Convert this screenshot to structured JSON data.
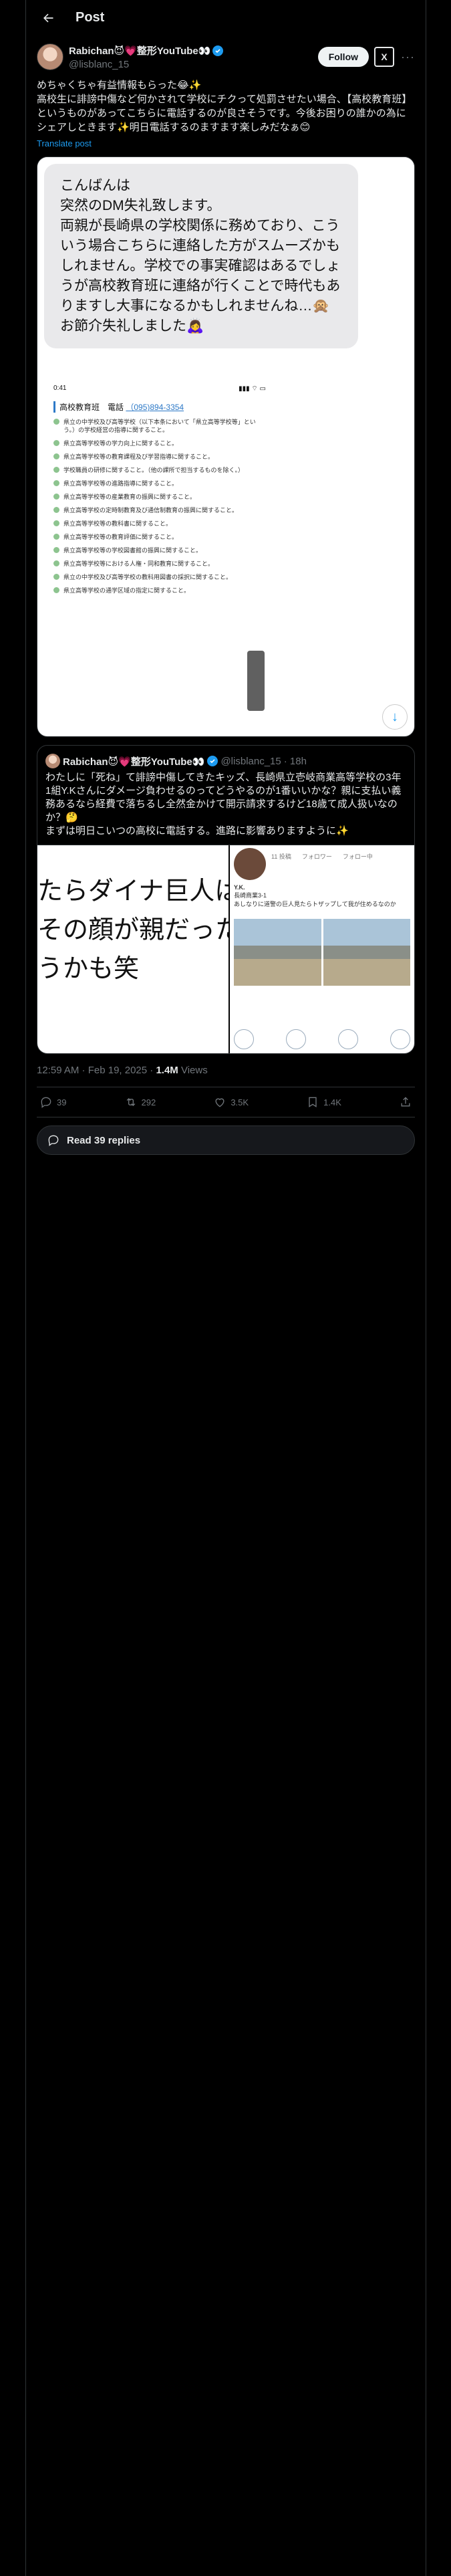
{
  "header": {
    "title": "Post"
  },
  "author": {
    "name": "Rabichan😈💗整形YouTube👀",
    "handle": "@lisblanc_15",
    "follow_label": "Follow",
    "grok_label": "X"
  },
  "tweet": {
    "text": "めちゃくちゃ有益情報もらった😂✨\n高校生に誹謗中傷など何かされて学校にチクって処罰させたい場合、【高校教育班】というものがあってこちらに電話するのが良さそうです。今後お困りの誰かの為にシェアしときます✨明日電話するのますます楽しみだなぁ😊",
    "translate_label": "Translate post"
  },
  "media": {
    "bubble_text": "こんばんは\n突然のDM失礼致します。\n両親が長崎県の学校関係に務めており、こういう場合こちらに連絡した方がスムーズかもしれません。学校での事実確認はあるでしょうが高校教育班に連絡が行くことで時代もありますし大事になるかもしれませんね…🙊\nお節介失礼しました🙇‍♀️",
    "phone_time": "0:41",
    "phone_signal": "▮▮▮ ⌔ ▭",
    "phone_heading": "高校教育班　電話",
    "phone_tel": "（095)894-3354",
    "phone_items": [
      "県立の中学校及び高等学校（以下本条において「県立高等学校等」という。）の学校経営の指導に関すること。",
      "県立高等学校等の学力向上に関すること。",
      "県立高等学校等の教育課程及び学習指導に関すること。",
      "学校職員の研修に関すること。（他の課所で担当するものを除く。）",
      "県立高等学校等の進路指導に関すること。",
      "県立高等学校等の産業教育の振興に関すること。",
      "県立高等学校の定時制教育及び通信制教育の振興に関すること。",
      "県立高等学校等の教科書に関すること。",
      "県立高等学校等の教育評価に関すること。",
      "県立高等学校等の学校図書館の振興に関すること。",
      "県立高等学校等における人権・同和教育に関すること。",
      "県立の中学校及び高等学校の教科用図書の採択に関すること。",
      "県立高等学校の通学区域の指定に関すること。"
    ]
  },
  "quote": {
    "name": "Rabichan😈💗整形YouTube👀",
    "handle": "@lisblanc_15",
    "time": "· 18h",
    "text": "わたしに「死ね」て誹謗中傷してきたキッズ、長崎県立壱岐商業高等学校の3年1組Y.Kさんにダメージ負わせるのってどうやるのが1番いいかな？親に支払い義務あるなら経費で落ちるし全然金かけて開示請求するけど18歳て成人扱いなのか？🤔\nまずは明日こいつの高校に電話する。進路に影響ありますように✨",
    "media_left_text": "たらダイナ巨人は\nその顔が親だった\nうかも笑",
    "profile_name": "Y.K.",
    "profile_school": "長崎商業3-1",
    "profile_bio": "あしなりに道警の巨人見たらトザップして我が住めるなのか",
    "profile_stats": [
      "11 投稿",
      "フォロワー",
      "フォロー中"
    ]
  },
  "meta": {
    "time": "12:59 AM · Feb 19, 2025 · ",
    "views_count": "1.4M",
    "views_label": " Views"
  },
  "actions": {
    "replies": "39",
    "reposts": "292",
    "likes": "3.5K",
    "bookmarks": "1.4K"
  },
  "read_replies": "Read 39 replies",
  "colors": {
    "accent": "#1d9bf0",
    "border": "#2f3336",
    "muted": "#71767b"
  }
}
